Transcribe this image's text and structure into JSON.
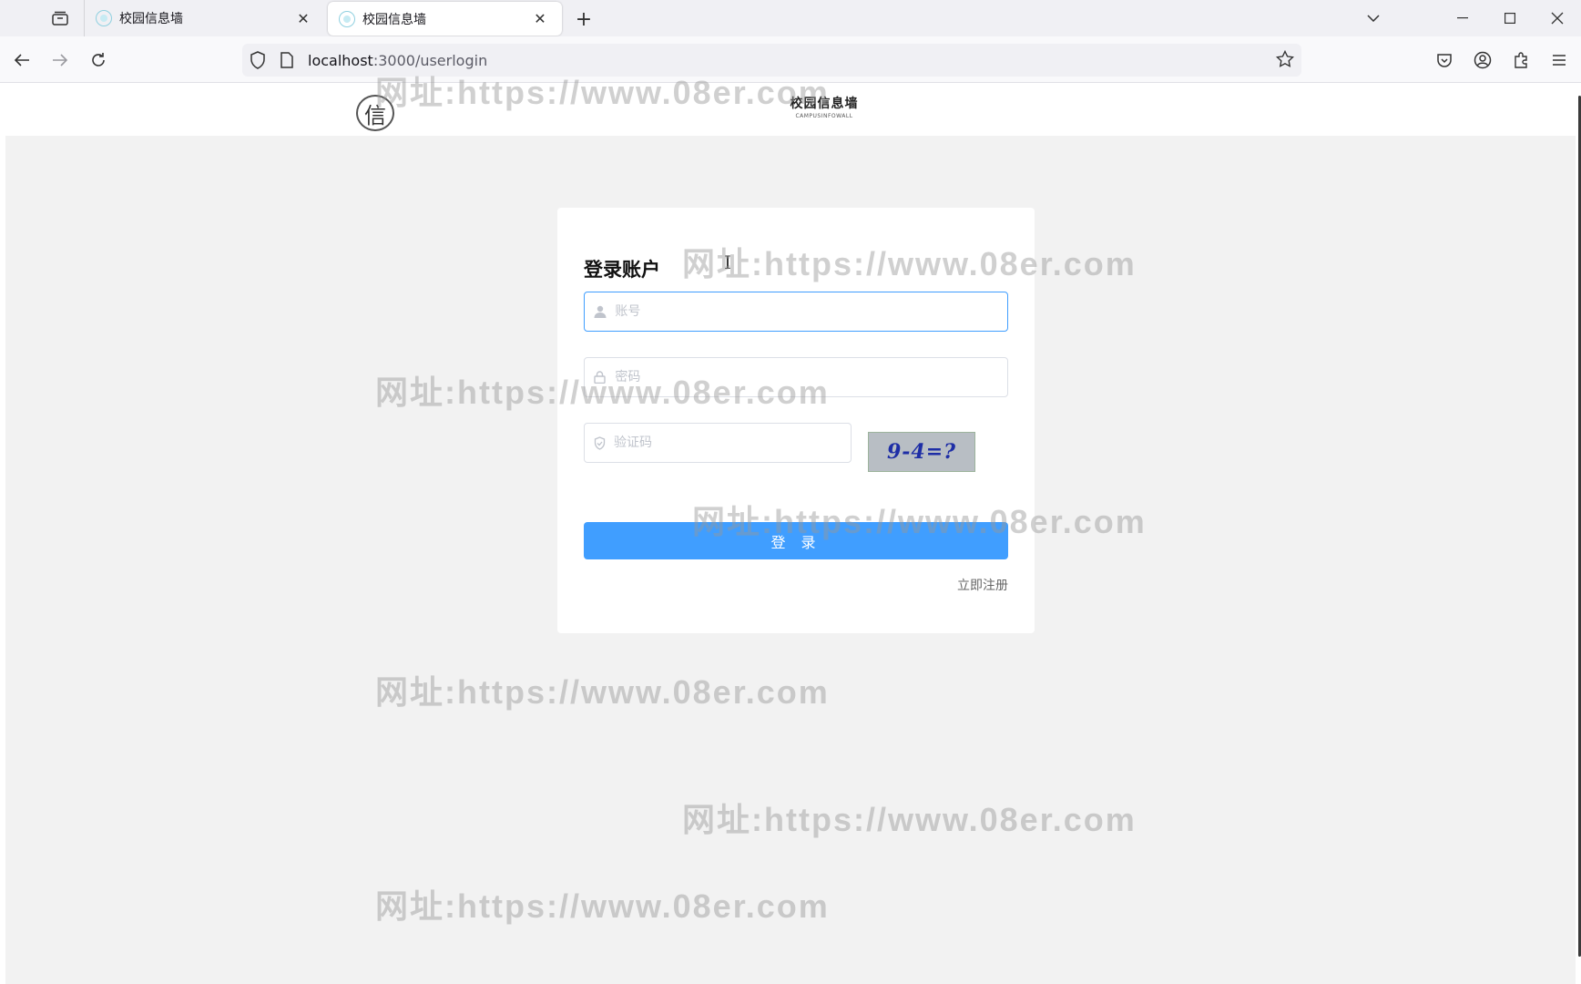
{
  "browser": {
    "tabs": [
      {
        "title": "校园信息墙"
      },
      {
        "title": "校园信息墙"
      }
    ],
    "url_host": "localhost",
    "url_path": ":3000/userlogin"
  },
  "header": {
    "logo_char": "信",
    "brand_cn": "校园信息墙",
    "brand_en": "CAMPUSINFOWALL"
  },
  "login": {
    "title": "登录账户",
    "account_placeholder": "账号",
    "password_placeholder": "密码",
    "captcha_placeholder": "验证码",
    "captcha_text": "9-4=?",
    "submit_label": "登 录",
    "register_label": "立即注册"
  },
  "watermark": {
    "text": "网址:https://www.08er.com"
  }
}
